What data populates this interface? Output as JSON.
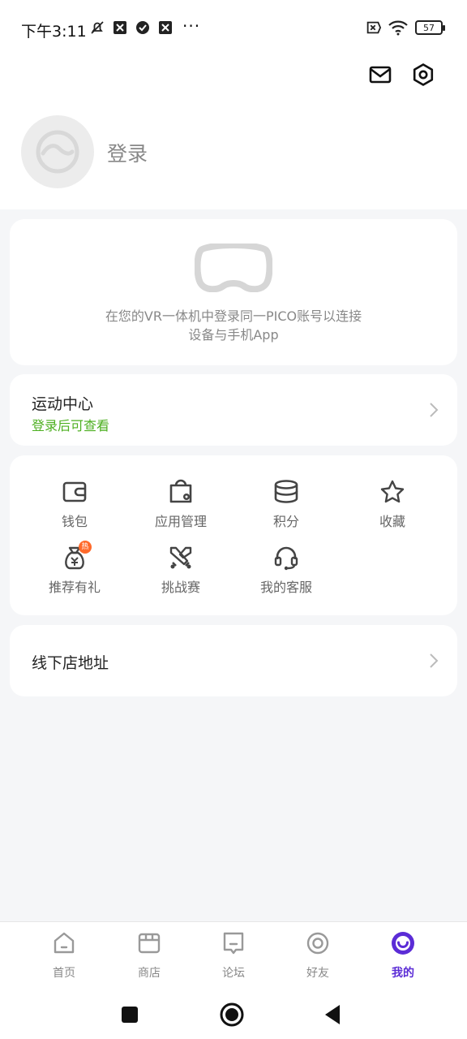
{
  "status_bar": {
    "time": "下午3:11",
    "more": "···",
    "battery": "57"
  },
  "header": {
    "login_label": "登录",
    "icons": [
      "mail-icon",
      "settings-icon"
    ]
  },
  "vr_card": {
    "line1": "在您的VR一体机中登录同一PICO账号以连接",
    "line2": "设备与手机App"
  },
  "sport_center": {
    "title": "运动中心",
    "subtitle": "登录后可查看",
    "subtitle_color": "#4caf1f"
  },
  "grid": {
    "items": [
      {
        "label": "钱包",
        "icon": "wallet-icon"
      },
      {
        "label": "应用管理",
        "icon": "app-manage-icon"
      },
      {
        "label": "积分",
        "icon": "points-icon"
      },
      {
        "label": "收藏",
        "icon": "star-icon"
      },
      {
        "label": "推荐有礼",
        "icon": "referral-gift-icon",
        "badge": "热"
      },
      {
        "label": "挑战赛",
        "icon": "challenge-swords-icon"
      },
      {
        "label": "我的客服",
        "icon": "headset-icon"
      }
    ]
  },
  "store_address": {
    "title": "线下店地址"
  },
  "tabs": [
    {
      "label": "首页",
      "icon": "home-icon"
    },
    {
      "label": "商店",
      "icon": "store-icon"
    },
    {
      "label": "论坛",
      "icon": "forum-icon"
    },
    {
      "label": "好友",
      "icon": "friends-icon"
    },
    {
      "label": "我的",
      "icon": "me-icon",
      "active": true
    }
  ],
  "colors": {
    "accent": "#5b2cd6",
    "background": "#f5f6f8",
    "hot_badge": "#ff6a2b"
  }
}
